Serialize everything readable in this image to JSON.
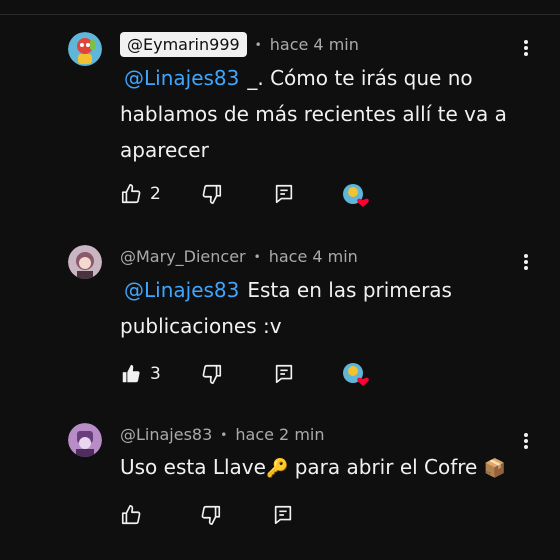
{
  "comments": [
    {
      "author": "@Eymarin999",
      "time": "hace 4 min",
      "mention": "@Linajes83",
      "text": "_. Cómo te irás que no hablamos de más recientes allí te va a aparecer",
      "likes": "2",
      "liked": false,
      "hearted": true
    },
    {
      "author": "@Mary_Diencer",
      "time": "hace 4 min",
      "mention": "@Linajes83",
      "text": "Esta en las primeras publicaciones :v",
      "likes": "3",
      "liked": true,
      "hearted": true
    },
    {
      "author": "@Linajes83",
      "time": "hace 2 min",
      "text_a": "Uso esta Llave",
      "emoji_a": "🔑",
      "text_b": " para abrir el Cofre ",
      "emoji_b": "📦",
      "likes": "",
      "liked": false,
      "hearted": false
    }
  ],
  "colors": {
    "background": "#0f0f0f",
    "mention": "#3ea6ff",
    "heart": "#ff0033",
    "secondary_text": "#aaaaaa"
  },
  "icons": [
    "thumb-up-icon",
    "thumb-down-icon",
    "reply-icon",
    "more-vert-icon",
    "creator-heart-icon"
  ]
}
